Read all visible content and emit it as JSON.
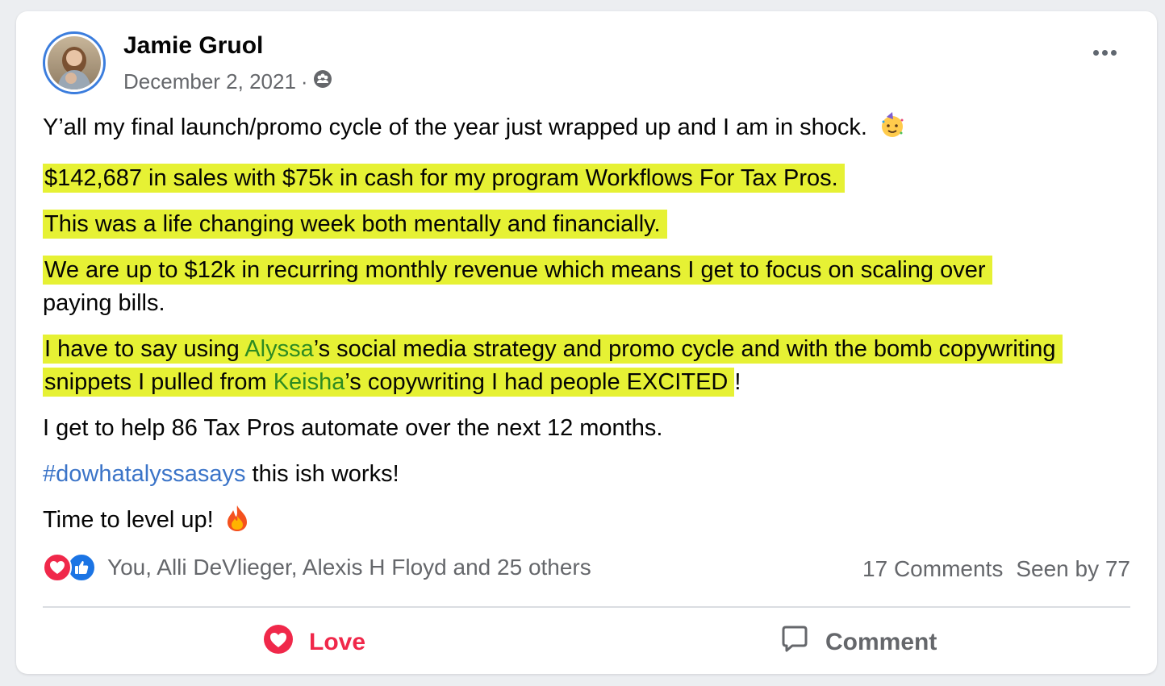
{
  "post": {
    "author": "Jamie Gruol",
    "date": "December 2, 2021",
    "separator": "·",
    "audience_icon": "group-audience-icon",
    "lines": {
      "intro": "Y’all my final launch/promo cycle of the year just wrapped up and I am in shock.",
      "sales": "$142,687 in sales with $75k in cash for my program Workflows For Tax Pros.",
      "life": "This was a life changing week both mentally and financially.",
      "mrr": "We are up to $12k in recurring monthly revenue which means I get to focus on scaling over",
      "mrr_tail": "paying bills.",
      "thanks_a": "I have to say using ",
      "mention_1": "Alyssa",
      "thanks_b": "’s social media strategy and promo cycle and with the bomb copywriting snippets I pulled from ",
      "mention_2": "Keisha",
      "thanks_c": "’s copywriting I had people EXCITED",
      "thanks_end": "!",
      "help": "I get to help 86 Tax Pros automate over the next 12 months.",
      "hashtag": "#dowhatalyssasays",
      "hashtag_tail": " this ish works!",
      "levelup": "Time to level up!"
    }
  },
  "reactions": {
    "types": [
      "love",
      "like"
    ],
    "names": "You, Alli DeVlieger, Alexis H Floyd and 25 others",
    "comments": "17 Comments",
    "seen": "Seen by 77"
  },
  "actions": {
    "love_label": "Love",
    "comment_label": "Comment"
  },
  "colors": {
    "highlight": "#e6f134",
    "mention": "#2e8b22",
    "hashtag": "#3b74c8",
    "love": "#f0284a",
    "like": "#1b74e4",
    "secondary_text": "#65676b"
  }
}
